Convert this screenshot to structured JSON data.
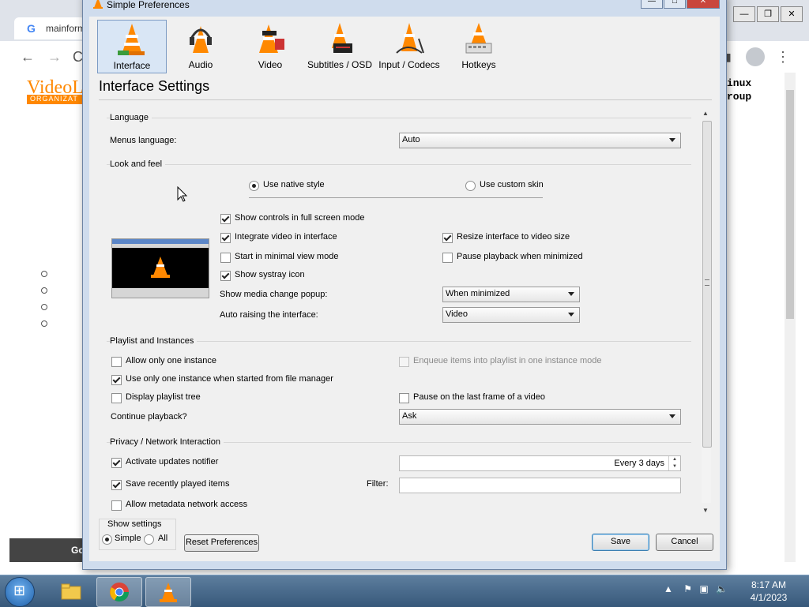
{
  "browser": {
    "tab_title": "mainform",
    "logo_text": "VideoLA",
    "logo_band": "ORGANIZAT",
    "right_code_line1": "inux",
    "right_code_line2": "roup",
    "footer_text": "Go"
  },
  "dialog": {
    "title": "Simple Preferences",
    "categories": [
      {
        "label": "Interface"
      },
      {
        "label": "Audio"
      },
      {
        "label": "Video"
      },
      {
        "label": "Subtitles / OSD"
      },
      {
        "label": "Input / Codecs"
      },
      {
        "label": "Hotkeys"
      }
    ],
    "heading": "Interface Settings",
    "language": {
      "group_title": "Language",
      "menus_language_label": "Menus language:",
      "menus_language_value": "Auto"
    },
    "look_and_feel": {
      "group_title": "Look and feel",
      "native_style": "Use native style",
      "custom_skin": "Use custom skin",
      "show_controls_fullscreen": "Show controls in full screen mode",
      "integrate_video": "Integrate video in interface",
      "resize_interface": "Resize interface to video size",
      "start_minimal": "Start in minimal view mode",
      "pause_minimized": "Pause playback when minimized",
      "show_systray": "Show systray icon",
      "media_change_popup_label": "Show media change popup:",
      "media_change_popup_value": "When minimized",
      "auto_raise_label": "Auto raising the interface:",
      "auto_raise_value": "Video"
    },
    "playlist": {
      "group_title": "Playlist and Instances",
      "one_instance": "Allow only one instance",
      "enqueue_items": "Enqueue items into playlist in one instance mode",
      "one_instance_file_manager": "Use only one instance when started from file manager",
      "display_tree": "Display playlist tree",
      "pause_last_frame": "Pause on the last frame of a video",
      "continue_label": "Continue playback?",
      "continue_value": "Ask"
    },
    "privacy": {
      "group_title": "Privacy / Network Interaction",
      "updates_notifier": "Activate updates notifier",
      "updates_interval": "Every 3 days",
      "save_recent": "Save recently played items",
      "filter_label": "Filter:",
      "filter_value": "",
      "metadata_access": "Allow metadata network access"
    },
    "show_settings": {
      "title": "Show settings",
      "simple": "Simple",
      "all": "All"
    },
    "buttons": {
      "reset": "Reset Preferences",
      "save": "Save",
      "cancel": "Cancel"
    }
  },
  "taskbar": {
    "time": "8:17 AM",
    "date": "4/1/2023"
  },
  "colors": {
    "vlc_orange": "#ff8800",
    "dialog_frame": "#cfdced",
    "taskbar": "#37587a"
  }
}
